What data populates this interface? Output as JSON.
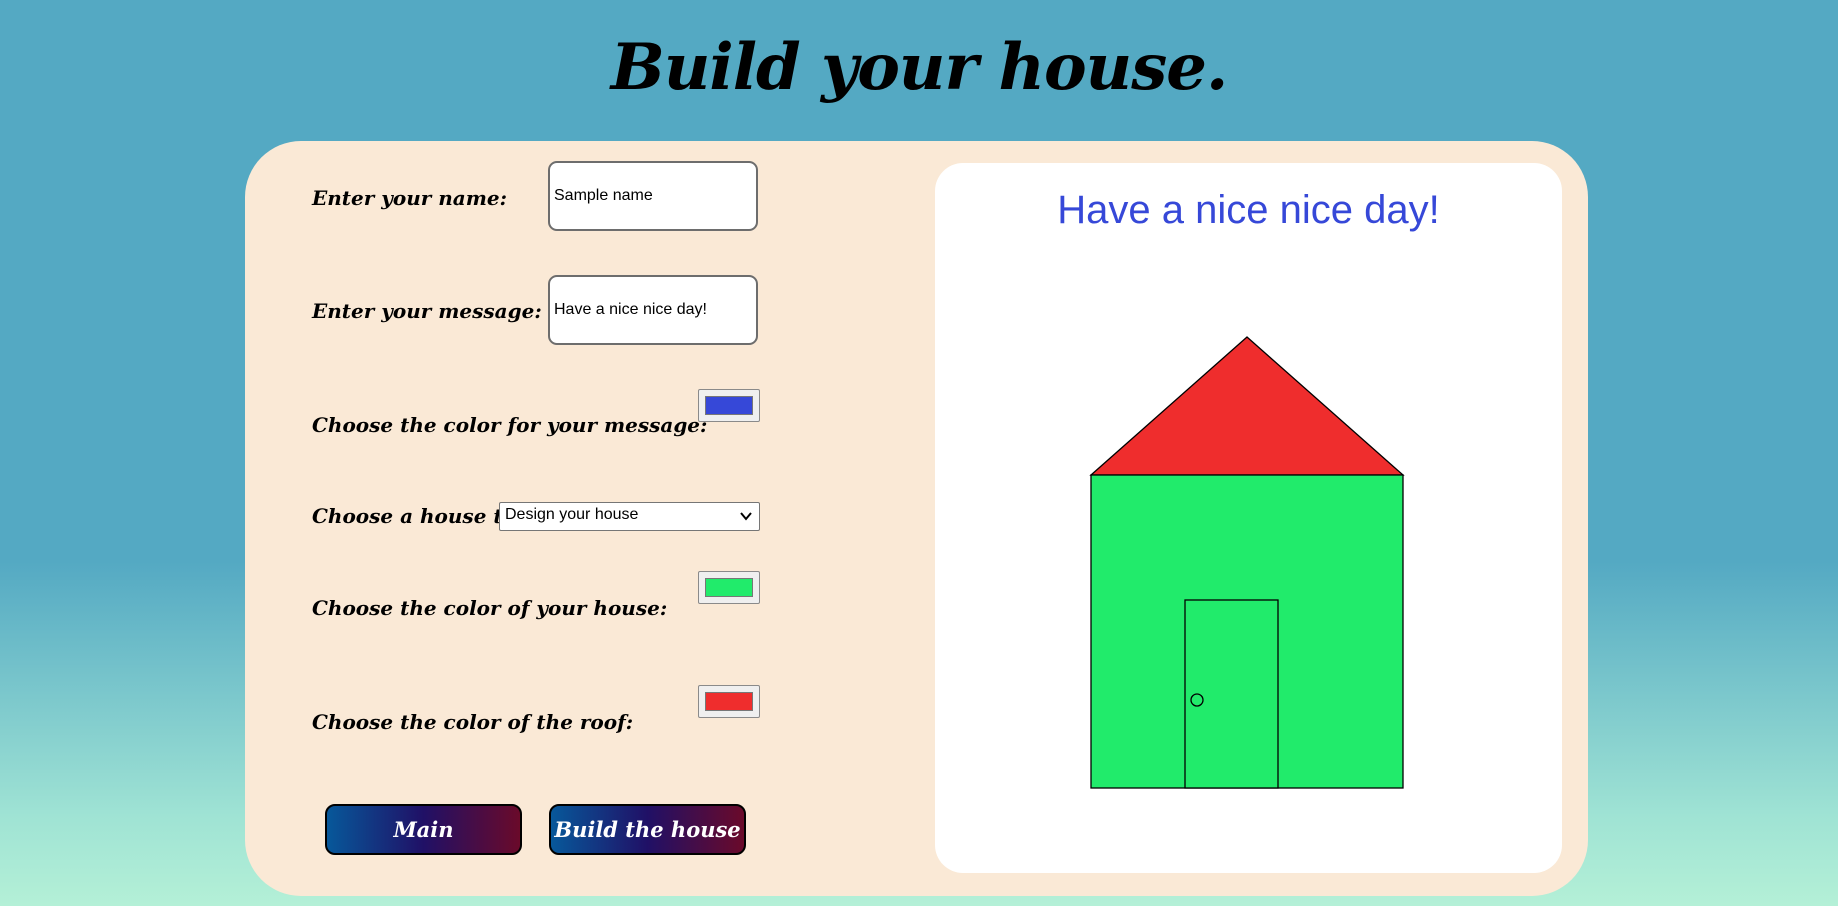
{
  "page": {
    "title": "Build your house."
  },
  "form": {
    "name_label": "Enter your name:",
    "name_value": "Sample name",
    "message_label": "Enter your message:",
    "message_value": "Have a nice nice day!",
    "message_color_label": "Choose the color for your message:",
    "message_color": "#3648d8",
    "house_type_label": "Choose a house type:",
    "house_type_selected": "Design your house",
    "house_color_label": "Choose the color of your house:",
    "house_color": "#21eb6b",
    "roof_color_label": "Choose the color of the roof:",
    "roof_color": "#ef2d2d"
  },
  "buttons": {
    "main_label": "Main",
    "build_label": "Build the house"
  },
  "preview": {
    "message": "Have a nice nice day!"
  }
}
